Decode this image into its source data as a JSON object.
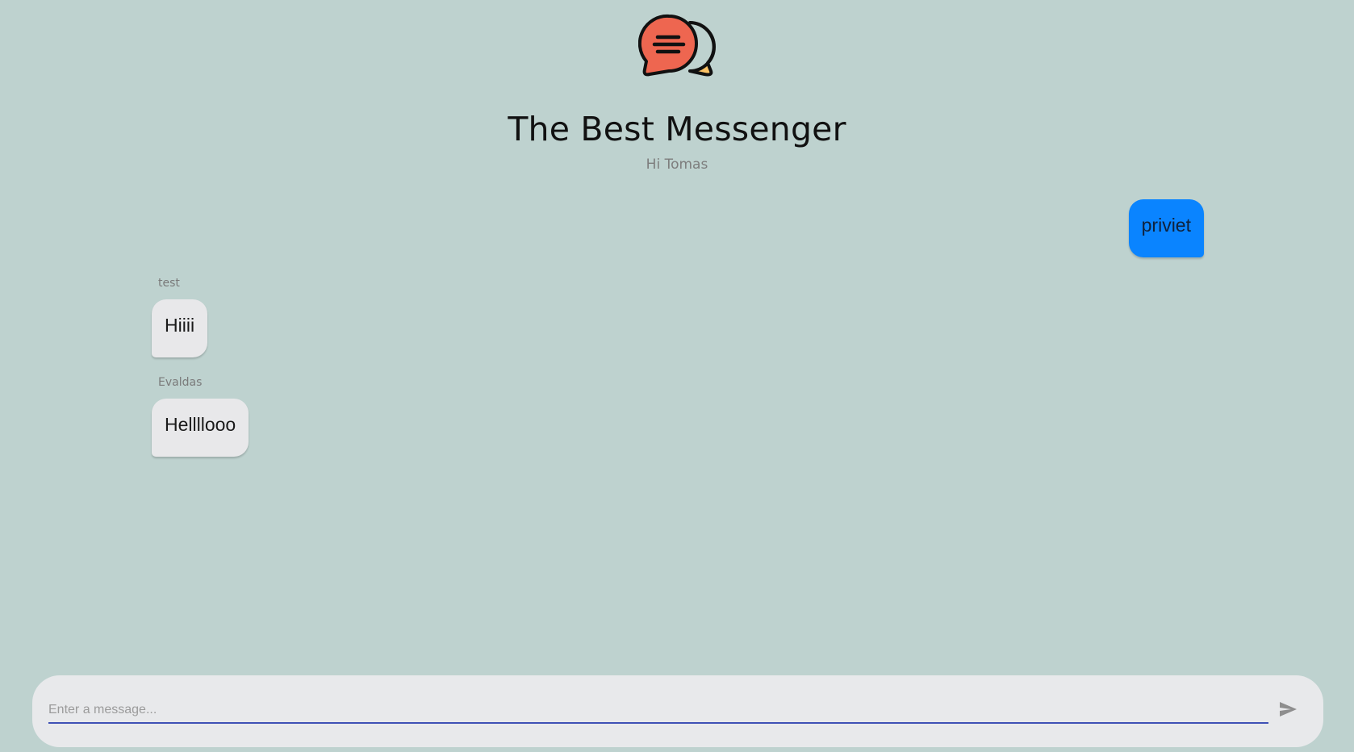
{
  "header": {
    "title": "The Best Messenger",
    "greeting": "Hi Tomas",
    "logo_icon": "chat-bubbles-icon"
  },
  "messages": [
    {
      "direction": "outgoing",
      "sender": "",
      "text": "priviet",
      "color": "#0a84ff"
    },
    {
      "direction": "incoming",
      "sender": "test",
      "text": "Hiiii",
      "color": "#e8e8ea"
    },
    {
      "direction": "incoming",
      "sender": "Evaldas",
      "text": "Hellllooo",
      "color": "#e8e8ea"
    }
  ],
  "composer": {
    "placeholder": "Enter a message...",
    "value": "",
    "send_icon": "send-icon"
  },
  "colors": {
    "background": "#bed2cf",
    "outgoing_bubble": "#0a84ff",
    "incoming_bubble": "#e8e8ea",
    "composer_background": "#e8e9eb",
    "input_underline": "#3f51b5"
  }
}
